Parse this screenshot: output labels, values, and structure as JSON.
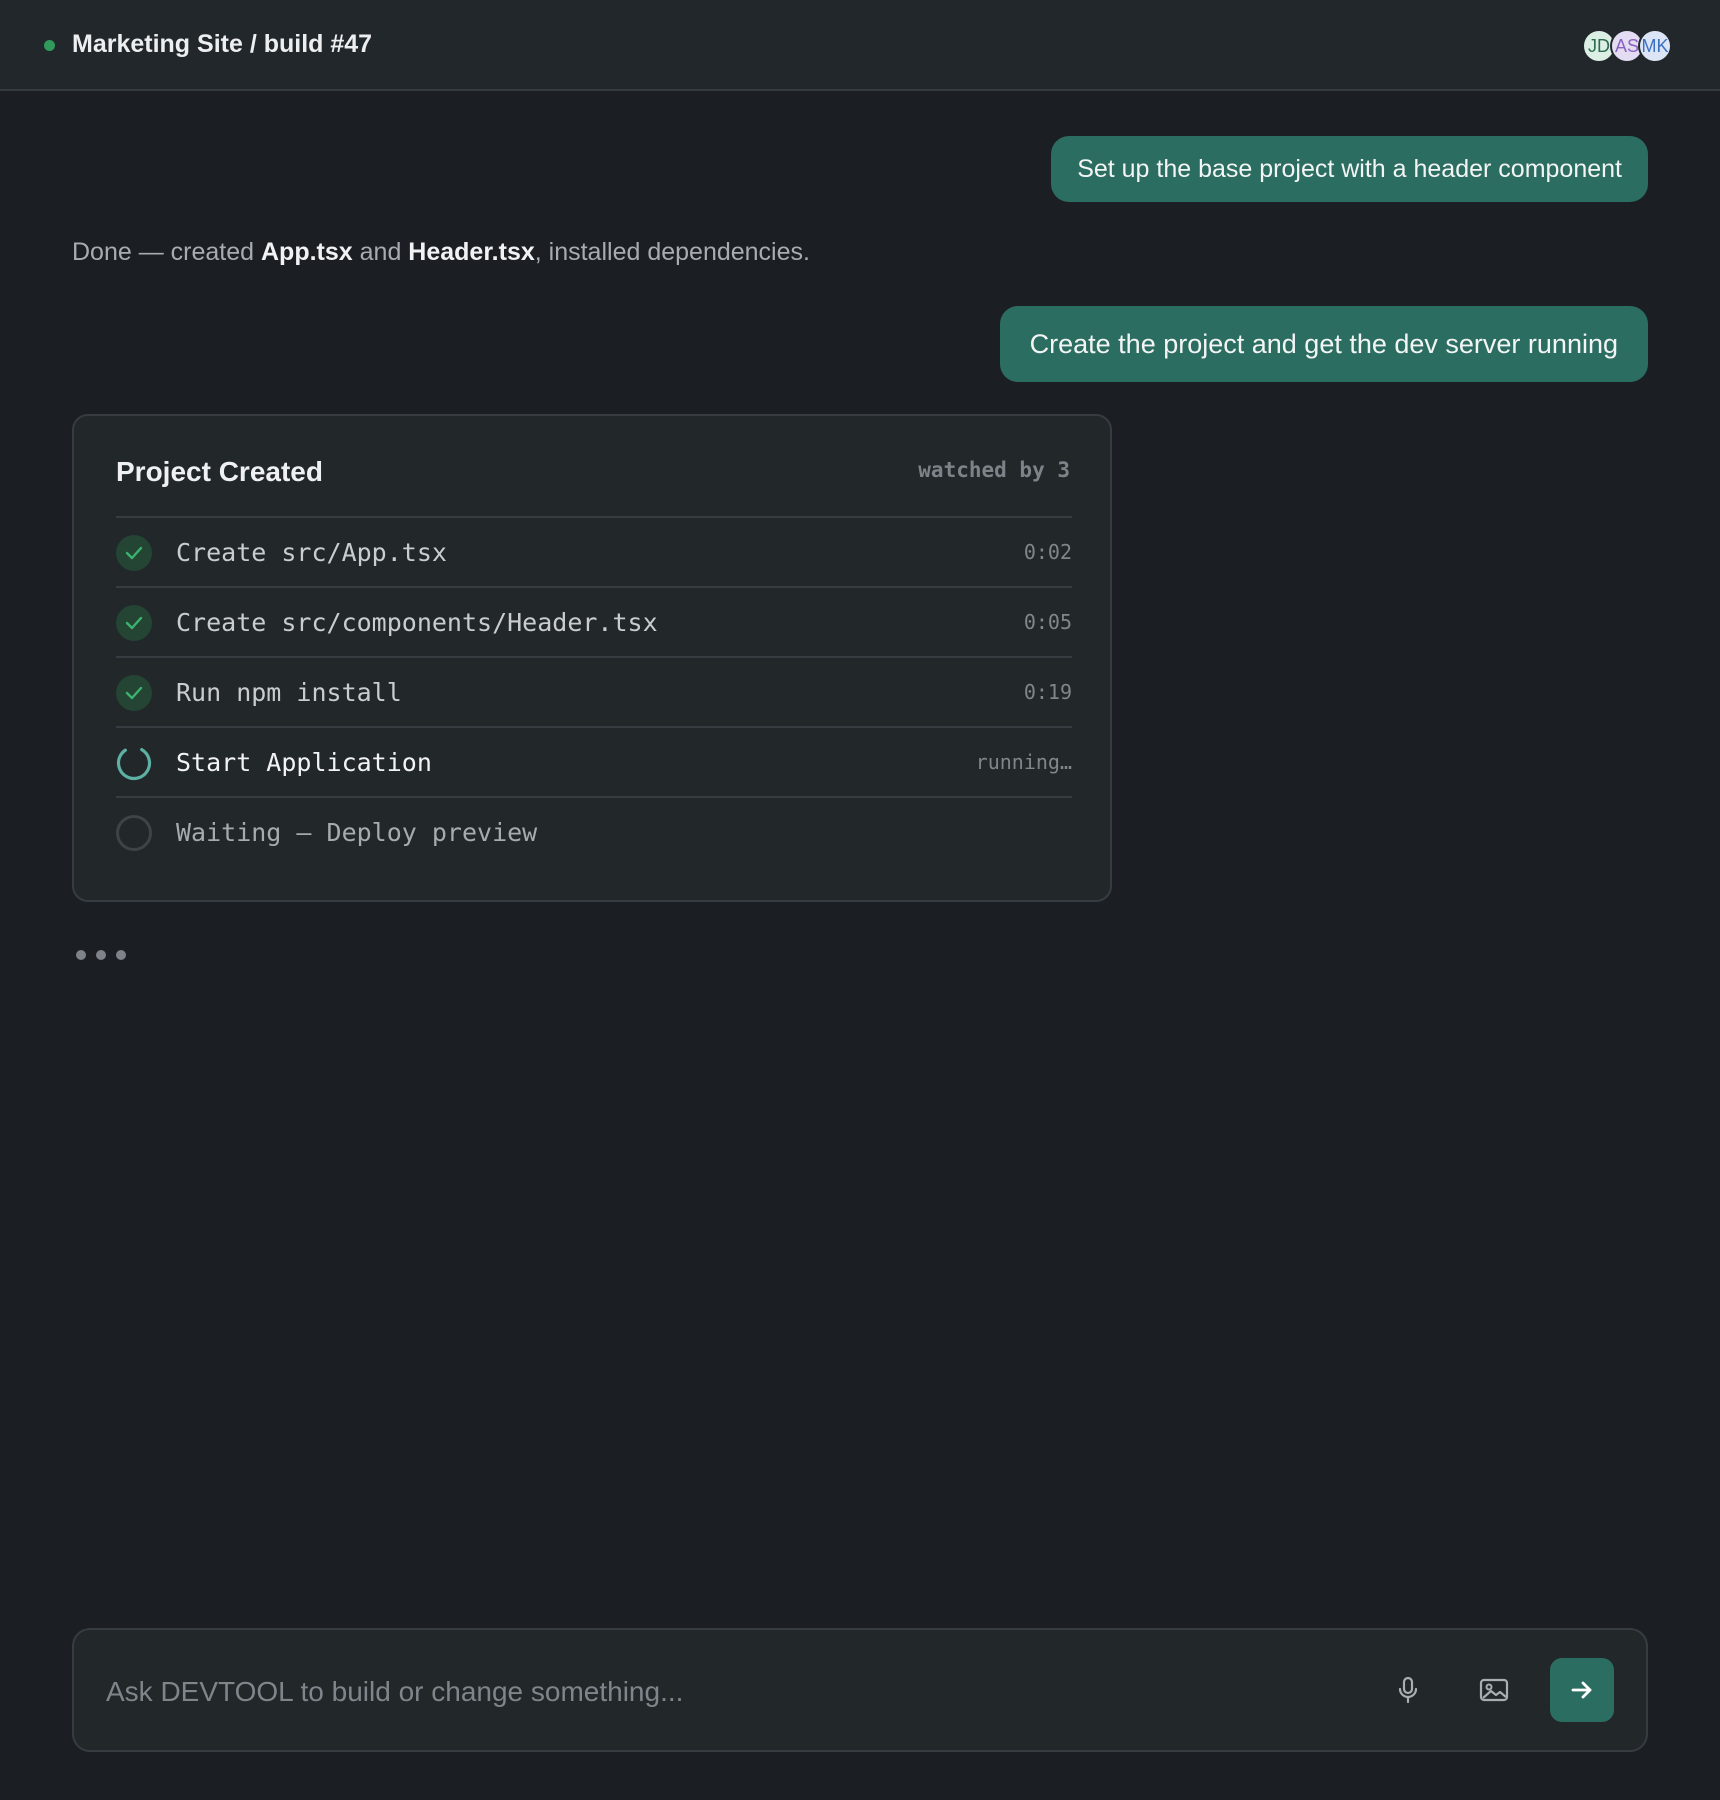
{
  "header": {
    "title": "Marketing Site / build #47",
    "status_color": "#2f9a5c",
    "avatars": [
      "JD",
      "AS",
      "MK"
    ]
  },
  "messages": {
    "user1": "Set up the base project with a header component",
    "assistant1": {
      "prefix": "Done — created ",
      "file1": "App.tsx",
      "mid": " and ",
      "file2": "Header.tsx",
      "suffix": ", installed dependencies."
    },
    "user2": "Create the project and get the dev server running"
  },
  "card": {
    "title": "Project Created",
    "watchers": "watched by 3",
    "steps": [
      {
        "label": "Create src/App.tsx",
        "time": "0:02",
        "status": "done"
      },
      {
        "label": "Create src/components/Header.tsx",
        "time": "0:05",
        "status": "done"
      },
      {
        "label": "Run npm install",
        "time": "0:19",
        "status": "done"
      },
      {
        "label": "Start Application",
        "time": "running…",
        "status": "running"
      },
      {
        "label": "Waiting — Deploy preview",
        "time": "",
        "status": "pending"
      }
    ]
  },
  "composer": {
    "placeholder": "Ask DEVTOOL to build or change something...",
    "icons": [
      "microphone-icon",
      "image-icon",
      "arrow-right-icon"
    ]
  },
  "colors": {
    "accent": "#2c6d62",
    "success": "#2f9a5c",
    "background": "#1b1e22"
  }
}
